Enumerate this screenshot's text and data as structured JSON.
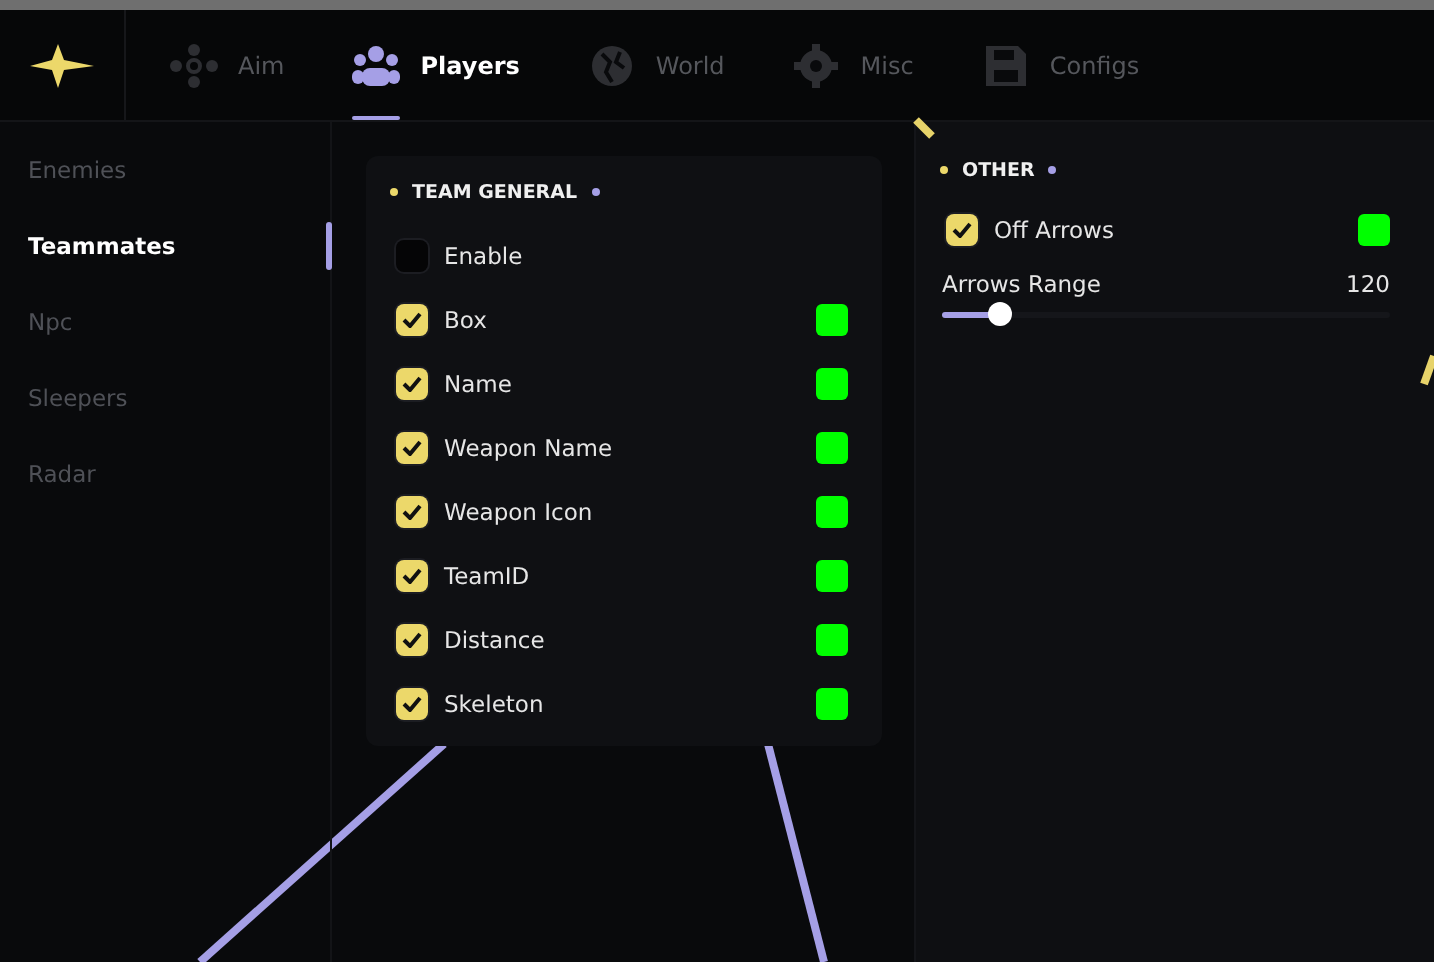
{
  "tabs": [
    {
      "label": "Aim",
      "selected": false
    },
    {
      "label": "Players",
      "selected": true
    },
    {
      "label": "World",
      "selected": false
    },
    {
      "label": "Misc",
      "selected": false
    },
    {
      "label": "Configs",
      "selected": false
    }
  ],
  "sidebar": {
    "items": [
      {
        "label": "Enemies",
        "selected": false
      },
      {
        "label": "Teammates",
        "selected": true
      },
      {
        "label": "Npc",
        "selected": false
      },
      {
        "label": "Sleepers",
        "selected": false
      },
      {
        "label": "Radar",
        "selected": false
      }
    ]
  },
  "team_general": {
    "title": "TEAM GENERAL",
    "options": [
      {
        "kind": "checkbox",
        "label": "Enable",
        "checked": false
      },
      {
        "kind": "checkbox",
        "label": "Box",
        "checked": true,
        "color": "#00ff00"
      },
      {
        "kind": "checkbox",
        "label": "Name",
        "checked": true,
        "color": "#00ff00"
      },
      {
        "kind": "checkbox",
        "label": "Weapon Name",
        "checked": true,
        "color": "#00ff00"
      },
      {
        "kind": "checkbox",
        "label": "Weapon Icon",
        "checked": true,
        "color": "#00ff00"
      },
      {
        "kind": "checkbox",
        "label": "TeamID",
        "checked": true,
        "color": "#00ff00"
      },
      {
        "kind": "checkbox",
        "label": "Distance",
        "checked": true,
        "color": "#00ff00"
      },
      {
        "kind": "checkbox",
        "label": "Skeleton",
        "checked": true,
        "color": "#00ff00"
      }
    ]
  },
  "other": {
    "title": "OTHER",
    "options": [
      {
        "kind": "checkbox",
        "label": "Off Arrows",
        "checked": true,
        "color": "#00ff00"
      },
      {
        "kind": "slider",
        "label": "Arrows Range",
        "reading": "120",
        "level": 0.13
      }
    ]
  }
}
